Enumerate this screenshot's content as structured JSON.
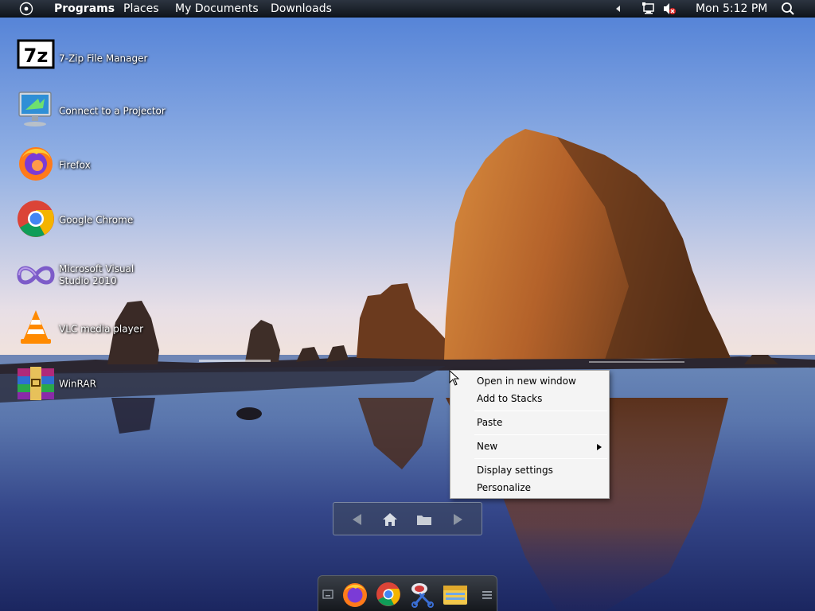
{
  "topbar": {
    "menus": [
      "Programs",
      "Places",
      "My Documents",
      "Downloads"
    ],
    "clock": "Mon 5:12 PM"
  },
  "desktop_icons": [
    {
      "label": "7-Zip File Manager",
      "icon": "7zip-icon"
    },
    {
      "label": "Connect to a Projector",
      "icon": "projector-icon"
    },
    {
      "label": "Firefox",
      "icon": "firefox-icon"
    },
    {
      "label": "Google Chrome",
      "icon": "chrome-icon"
    },
    {
      "label": "Microsoft Visual Studio 2010",
      "icon": "visual-studio-icon"
    },
    {
      "label": "VLC media player",
      "icon": "vlc-icon"
    },
    {
      "label": "WinRAR",
      "icon": "winrar-icon"
    }
  ],
  "seven_zip_badge": "7z",
  "context_menu": {
    "items": [
      "Open in new window",
      "Add to Stacks",
      "Paste",
      "New",
      "Display settings",
      "Personalize"
    ]
  },
  "colors": {
    "sky_top": "#5a86d6",
    "sea_dark": "#2a3a78",
    "rock": "#b8642a",
    "topbar": "#1c232c"
  }
}
